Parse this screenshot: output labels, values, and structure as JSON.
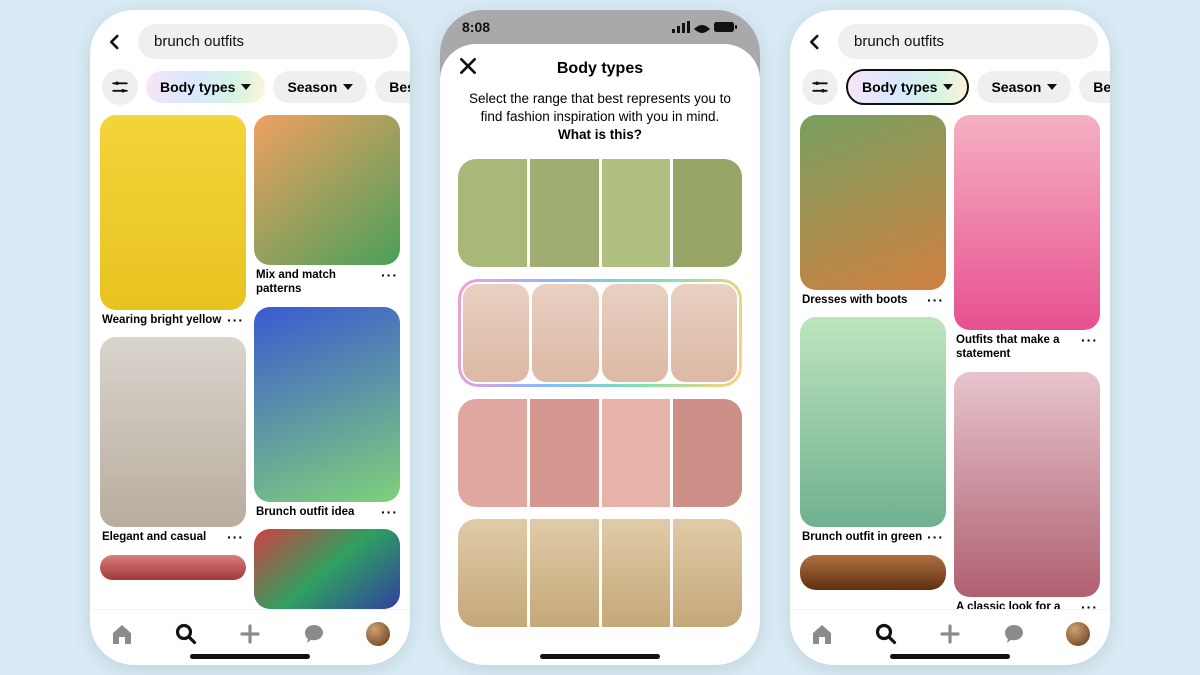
{
  "status_bar": {
    "time": "8:08"
  },
  "search": {
    "query": "brunch outfits"
  },
  "filters": {
    "body_types": "Body types",
    "season": "Season",
    "best_partial": "Bes",
    "best_full": "Best"
  },
  "sheet": {
    "title": "Body types",
    "subtitle_a": "Select the range that best represents you to find fashion inspiration with you in mind. ",
    "subtitle_b": "What is this?"
  },
  "phone1_pins": {
    "left": [
      {
        "title": "Wearing bright yellow"
      },
      {
        "title": "Elegant and casual"
      }
    ],
    "right": [
      {
        "title": "Mix and match patterns"
      },
      {
        "title": "Brunch outfit idea"
      }
    ]
  },
  "phone3_pins": {
    "left": [
      {
        "title": "Dresses with boots"
      },
      {
        "title": "Brunch outfit in green"
      }
    ],
    "right": [
      {
        "title": "Outfits that make a statement"
      },
      {
        "title": "A classic look for a Sunday brunch date"
      }
    ]
  },
  "nav": {
    "home": "home-icon",
    "search": "search-icon",
    "add": "add-icon",
    "messages": "messages-icon",
    "profile": "profile-avatar"
  }
}
